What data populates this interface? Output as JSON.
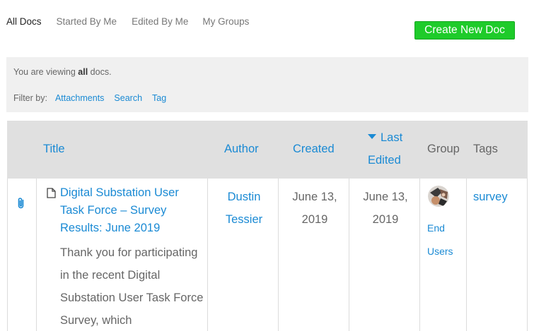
{
  "tabs": [
    {
      "label": "All Docs"
    },
    {
      "label": "Started By Me"
    },
    {
      "label": "Edited By Me"
    },
    {
      "label": "My Groups"
    }
  ],
  "create_button": "Create New Doc",
  "info": {
    "viewing_prefix": "You are viewing",
    "viewing_bold": "all",
    "viewing_suffix": "docs.",
    "filter_label": "Filter by:",
    "filters": [
      "Attachments",
      "Search",
      "Tag"
    ]
  },
  "table": {
    "headers": {
      "title": "Title",
      "author": "Author",
      "created": "Created",
      "last_edited_1": "Last",
      "last_edited_2": "Edited",
      "group": "Group",
      "tags": "Tags"
    },
    "rows": [
      {
        "title": "Digital Substation User Task Force – Survey Results: June 2019",
        "description": "Thank you for participating in the recent Digital Substation User Task Force Survey, which",
        "author_1": "Dustin",
        "author_2": "Tessier",
        "created_1": "June 13,",
        "created_2": "2019",
        "edited_1": "June 13,",
        "edited_2": "2019",
        "group_1": "End",
        "group_2": "Users",
        "tag": "survey"
      }
    ]
  },
  "icons": {
    "attachment": "paperclip-icon",
    "document": "document-icon",
    "sort": "sort-desc-triangle-icon",
    "group_avatar": "group-avatar"
  },
  "colors": {
    "link": "#1a8ad4",
    "create_button": "#1ecb2a",
    "header_bg": "#e0e0e0",
    "info_bg": "#f0f0f0"
  }
}
